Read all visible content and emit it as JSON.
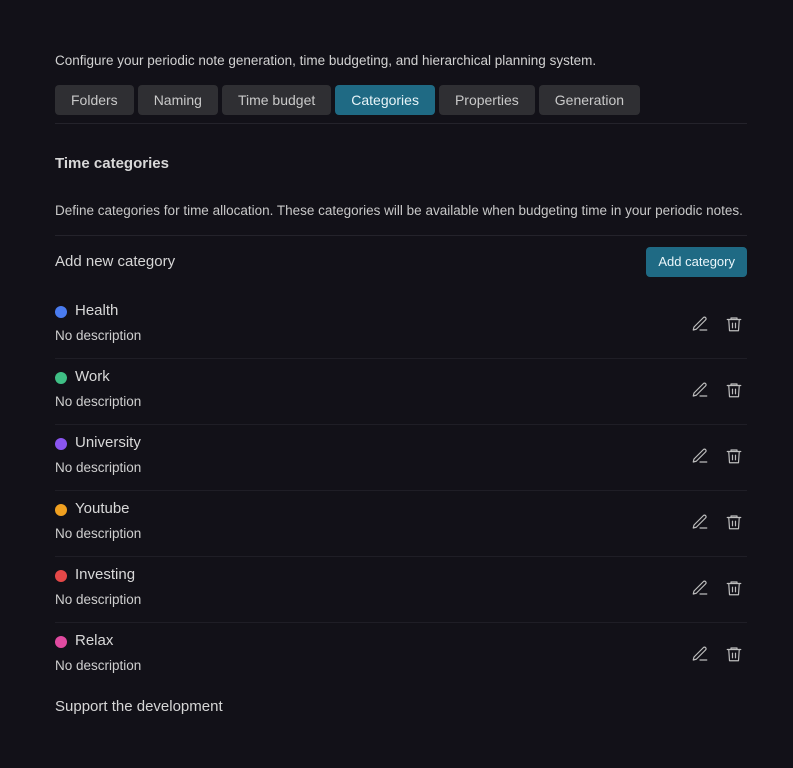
{
  "intro": "Configure your periodic note generation, time budgeting, and hierarchical planning system.",
  "tabs": [
    {
      "label": "Folders",
      "active": false
    },
    {
      "label": "Naming",
      "active": false
    },
    {
      "label": "Time budget",
      "active": false
    },
    {
      "label": "Categories",
      "active": true
    },
    {
      "label": "Properties",
      "active": false
    },
    {
      "label": "Generation",
      "active": false
    }
  ],
  "section": {
    "title": "Time categories",
    "description": "Define categories for time allocation. These categories will be available when budgeting time in your periodic notes."
  },
  "add": {
    "label": "Add new category",
    "button": "Add category"
  },
  "categories": [
    {
      "name": "Health",
      "description": "No description",
      "color": "#4a7cf0"
    },
    {
      "name": "Work",
      "description": "No description",
      "color": "#3fbf85"
    },
    {
      "name": "University",
      "description": "No description",
      "color": "#8a55f0"
    },
    {
      "name": "Youtube",
      "description": "No description",
      "color": "#f0a020"
    },
    {
      "name": "Investing",
      "description": "No description",
      "color": "#e54848"
    },
    {
      "name": "Relax",
      "description": "No description",
      "color": "#e04aa0"
    }
  ],
  "icons": {
    "edit": "pencil-icon",
    "delete": "trash-icon"
  },
  "support": "Support the development"
}
